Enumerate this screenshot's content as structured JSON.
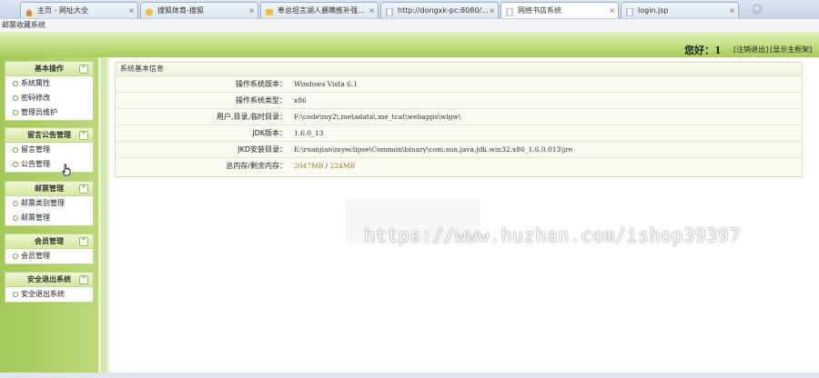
{
  "tabs": [
    {
      "label": "主页 - 网址大全",
      "active": false
    },
    {
      "label": "搜狐体育-搜狐",
      "active": false
    },
    {
      "label": "奉总坦言湖人暴瞒推补强...",
      "active": false
    },
    {
      "label": "http://dongxk-pc:8080/...",
      "active": false
    },
    {
      "label": "网络书店系统",
      "active": true
    },
    {
      "label": "login.jsp",
      "active": false
    }
  ],
  "window_title": "邮票收藏系统",
  "header": {
    "greeting": "您好：1",
    "logout": "[注销退出]",
    "show_home": "[显示主框架]"
  },
  "sidebar": [
    {
      "title": "基本操作",
      "items": [
        "系统属性",
        "密码修改",
        "管理员维护"
      ]
    },
    {
      "title": "留言公告管理",
      "items": [
        "留言管理",
        "公告管理"
      ]
    },
    {
      "title": "邮票管理",
      "items": [
        "邮票类别管理",
        "邮票管理"
      ]
    },
    {
      "title": "会员管理",
      "items": [
        "会员管理"
      ]
    },
    {
      "title": "安全退出系统",
      "items": [
        "安全退出系统"
      ]
    }
  ],
  "sysinfo": {
    "title": "系统基本信息",
    "rows": [
      {
        "label": "操作系统版本：",
        "value": "Windows Vista  6.1"
      },
      {
        "label": "操作系统类型：",
        "value": "x86"
      },
      {
        "label": "用户,目录,临时目录：",
        "value": "F:\\code\\my2\\.metadata\\.me_tcat\\webapps\\wlgw\\"
      },
      {
        "label": "JDK版本：",
        "value": "1.6.0_13"
      },
      {
        "label": "JKD安装目录：",
        "value": "E:\\ruanjian\\myeclipse\\Common\\binary\\com.sun.java.jdk.win32.x86_1.6.0.013\\jre"
      },
      {
        "label": "总内存/剩余内存：",
        "value_total": "2047MB",
        "value_sep": " / ",
        "value_free": "224MB"
      }
    ]
  },
  "watermark": "https://www.huzhan.com/ishop39397",
  "colors": {
    "accent_green": "#a8cc5a",
    "panel_border": "#c2d98f"
  }
}
